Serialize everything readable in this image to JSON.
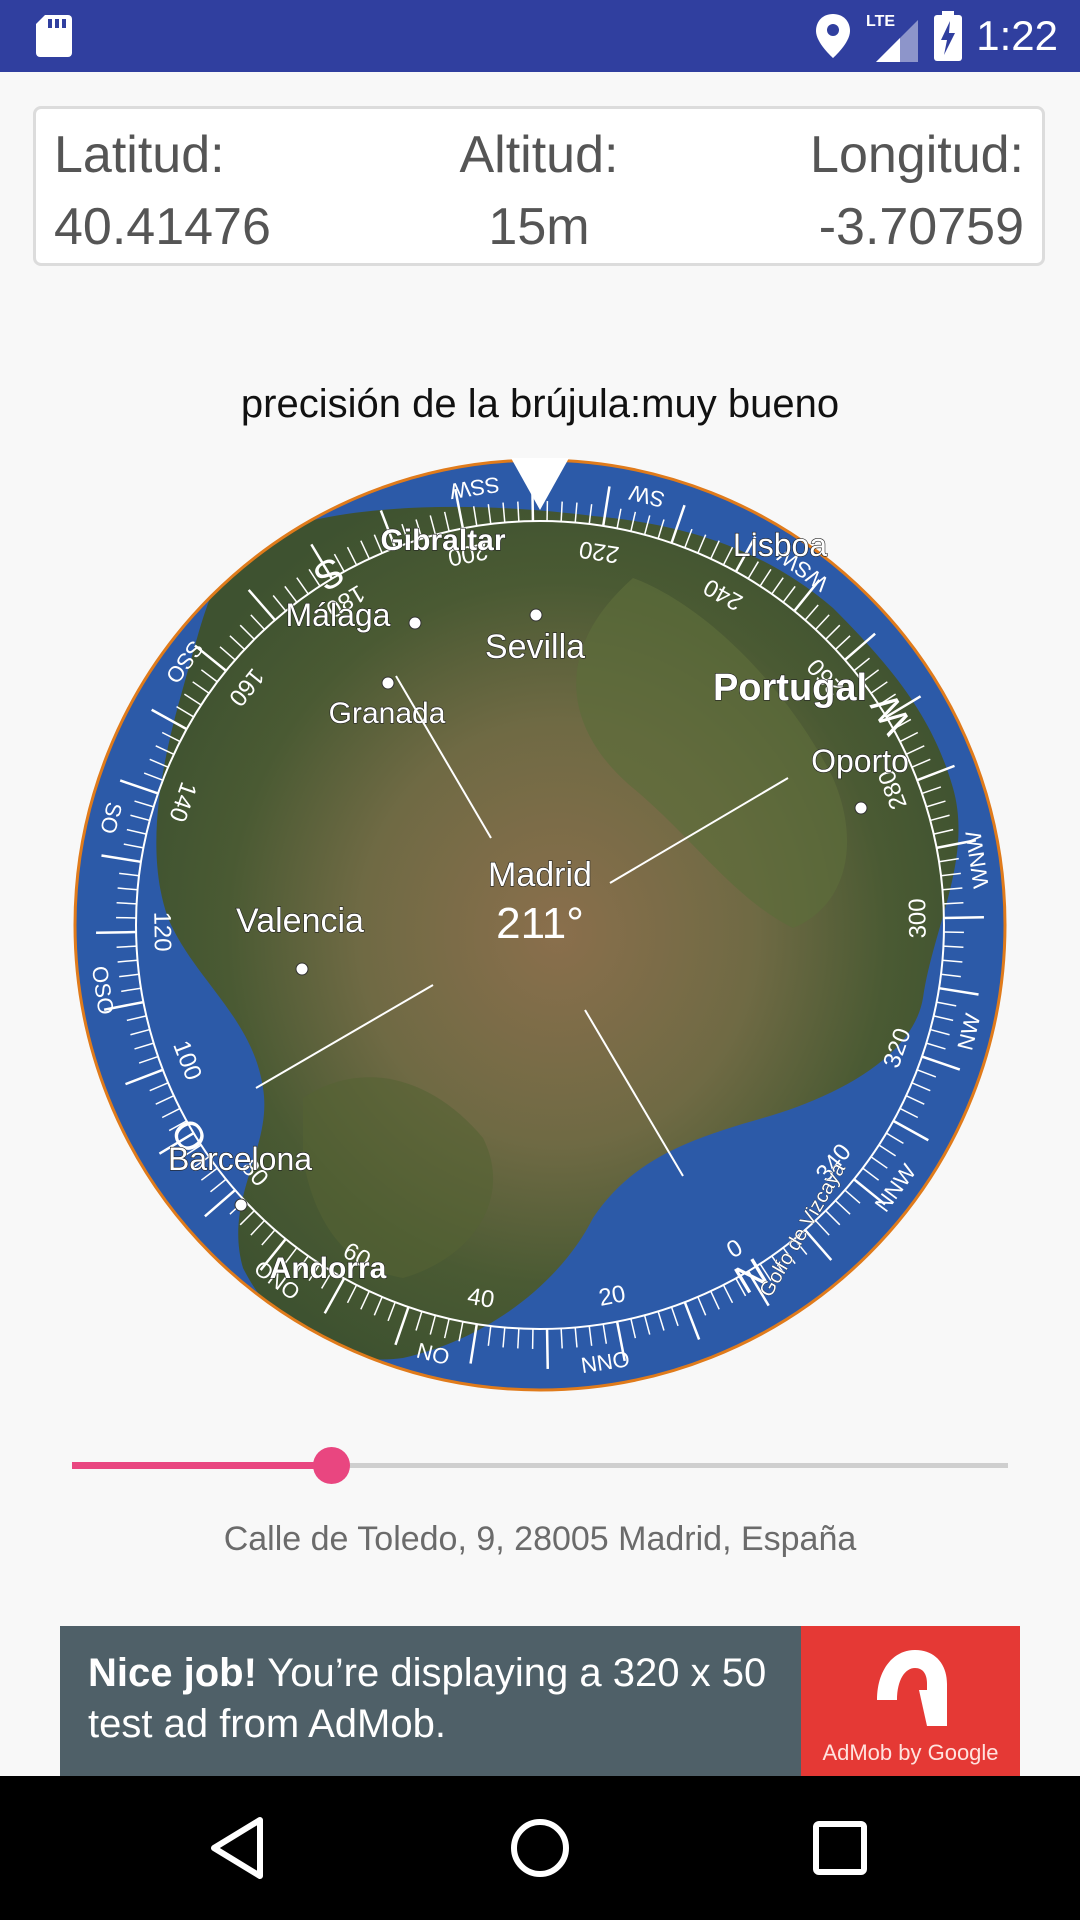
{
  "status_bar": {
    "time": "1:22",
    "network": "LTE",
    "icons": [
      "sd-card-icon",
      "location-icon",
      "signal-icon",
      "battery-charging-icon"
    ]
  },
  "coordinates": {
    "latitude_label": "Latitud:",
    "latitude_value": "40.41476",
    "altitude_label": "Altitud:",
    "altitude_value": "15m",
    "longitude_label": "Longitud:",
    "longitude_value": "-3.70759"
  },
  "precision_text": "precisión de la brújula:muy bueno",
  "compass": {
    "heading": "211°",
    "map_labels": [
      "Madrid",
      "Sevilla",
      "Granada",
      "Málaga",
      "Gibraltar",
      "Lisboa",
      "Portugal",
      "Oporto",
      "Valencia",
      "Barcelona",
      "Andorra",
      "Golfo de Vizcaya"
    ],
    "cardinals": [
      "N",
      "S",
      "W",
      "O"
    ],
    "intercardinals": [
      "SSW",
      "SW",
      "WSW",
      "WNW",
      "NW",
      "NNW",
      "NNO",
      "NO",
      "ONO",
      "OSO",
      "SO",
      "SSO"
    ],
    "degree_labels": [
      "0",
      "20",
      "40",
      "60",
      "80",
      "100",
      "120",
      "140",
      "160",
      "180",
      "200",
      "220",
      "240",
      "260",
      "280",
      "300",
      "320",
      "340"
    ],
    "colors": {
      "ring": "#ffffff",
      "border": "#e07b1b",
      "ocean": "#2c5aa8"
    }
  },
  "slider": {
    "value_fraction": 0.277,
    "active_color": "#e94680"
  },
  "address": "Calle de Toledo, 9, 28005 Madrid, España",
  "ad": {
    "headline": "Nice job!",
    "body": " You’re displaying a 320 x 50 test ad from AdMob.",
    "brand_text": "AdMob by Google",
    "colors": {
      "background": "#4f6068",
      "brand": "#e53935"
    }
  },
  "nav_bar": {
    "icons": [
      "back-icon",
      "home-icon",
      "recents-icon"
    ]
  }
}
